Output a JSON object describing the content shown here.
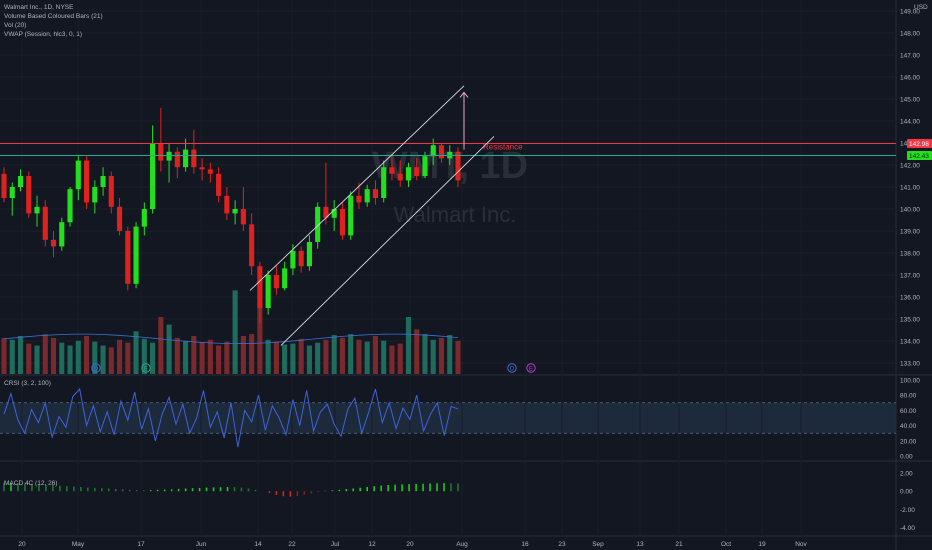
{
  "header": {
    "symbol_line": "Walmart Inc., 1D, NYSE",
    "indicators": [
      "Volume Based Coloured Bars (21)",
      "Vol (20)",
      "VWAP (Session, hlc3, 0, 1)"
    ],
    "currency": "USD"
  },
  "watermark": {
    "ticker": "WMT, 1D",
    "name": "Walmart Inc."
  },
  "price_labels": {
    "resistance_value": "142.98",
    "last_value": "142.43"
  },
  "annotations": {
    "resistance": "Resistance"
  },
  "colors": {
    "up": "#22e01e",
    "down": "#e0221e",
    "background": "#131722",
    "resistance_line": "#f23645",
    "support_line": "#22ab94",
    "crsi": "#3e63d8",
    "arrow": "#e8a5c8"
  },
  "event_markers": [
    "D",
    "E",
    "D",
    "E"
  ],
  "chart_data": [
    {
      "type": "candlestick",
      "title": "Walmart Inc., 1D, NYSE",
      "y_range": [
        132.5,
        149.5
      ],
      "y_ticks": [
        "149.00",
        "148.00",
        "147.00",
        "146.00",
        "145.00",
        "144.00",
        "143.00",
        "142.00",
        "141.00",
        "140.00",
        "139.00",
        "138.00",
        "137.00",
        "136.00",
        "135.00",
        "134.00",
        "133.00"
      ],
      "x_ticks": [
        "20",
        "May",
        "17",
        "Jun",
        "14",
        "22",
        "Jul",
        "12",
        "20",
        "Aug",
        "16",
        "23",
        "Sep",
        "13",
        "21",
        "Oct",
        "19",
        "Nov"
      ],
      "levels": {
        "resistance": 142.98,
        "support": 142.43
      },
      "channel_upper": [
        [
          137.4,
          137.0
        ],
        [
          142.8,
          143.6
        ]
      ],
      "ohlc_approx": [
        {
          "o": 141.6,
          "h": 141.9,
          "l": 140.3,
          "c": 140.5
        },
        {
          "o": 140.5,
          "h": 141.2,
          "l": 139.7,
          "c": 141.0
        },
        {
          "o": 141.0,
          "h": 141.8,
          "l": 140.8,
          "c": 141.5
        },
        {
          "o": 141.5,
          "h": 141.7,
          "l": 139.6,
          "c": 139.8
        },
        {
          "o": 139.8,
          "h": 140.6,
          "l": 139.2,
          "c": 140.1
        },
        {
          "o": 140.1,
          "h": 140.4,
          "l": 138.3,
          "c": 138.6
        },
        {
          "o": 138.6,
          "h": 139.0,
          "l": 137.8,
          "c": 138.3
        },
        {
          "o": 138.3,
          "h": 139.6,
          "l": 138.1,
          "c": 139.4
        },
        {
          "o": 139.4,
          "h": 141.0,
          "l": 139.2,
          "c": 140.9
        },
        {
          "o": 140.9,
          "h": 142.4,
          "l": 140.4,
          "c": 142.2
        },
        {
          "o": 142.2,
          "h": 142.4,
          "l": 140.0,
          "c": 140.3
        },
        {
          "o": 140.3,
          "h": 141.3,
          "l": 139.8,
          "c": 141.0
        },
        {
          "o": 141.0,
          "h": 141.9,
          "l": 140.6,
          "c": 141.5
        },
        {
          "o": 141.5,
          "h": 141.7,
          "l": 139.8,
          "c": 140.1
        },
        {
          "o": 140.1,
          "h": 140.5,
          "l": 138.8,
          "c": 139.0
        },
        {
          "o": 139.0,
          "h": 139.2,
          "l": 136.3,
          "c": 136.6
        },
        {
          "o": 136.6,
          "h": 139.4,
          "l": 136.4,
          "c": 139.2
        },
        {
          "o": 139.2,
          "h": 140.3,
          "l": 138.8,
          "c": 140.0
        },
        {
          "o": 140.0,
          "h": 143.8,
          "l": 139.8,
          "c": 143.0
        },
        {
          "o": 143.0,
          "h": 144.6,
          "l": 141.7,
          "c": 142.2
        },
        {
          "o": 142.2,
          "h": 143.0,
          "l": 141.2,
          "c": 142.6
        },
        {
          "o": 142.6,
          "h": 142.8,
          "l": 141.4,
          "c": 141.9
        },
        {
          "o": 141.9,
          "h": 143.2,
          "l": 141.7,
          "c": 142.7
        },
        {
          "o": 142.7,
          "h": 143.6,
          "l": 141.6,
          "c": 141.9
        },
        {
          "o": 141.9,
          "h": 142.3,
          "l": 141.3,
          "c": 141.8
        },
        {
          "o": 141.8,
          "h": 142.1,
          "l": 141.2,
          "c": 141.6
        },
        {
          "o": 141.6,
          "h": 141.9,
          "l": 140.3,
          "c": 140.6
        },
        {
          "o": 140.6,
          "h": 141.0,
          "l": 139.5,
          "c": 139.8
        },
        {
          "o": 139.8,
          "h": 140.4,
          "l": 139.3,
          "c": 140.0
        },
        {
          "o": 140.0,
          "h": 141.0,
          "l": 139.0,
          "c": 139.3
        },
        {
          "o": 139.3,
          "h": 139.8,
          "l": 137.0,
          "c": 137.4
        },
        {
          "o": 137.4,
          "h": 137.6,
          "l": 134.8,
          "c": 135.5
        },
        {
          "o": 135.5,
          "h": 137.2,
          "l": 135.2,
          "c": 137.0
        },
        {
          "o": 137.0,
          "h": 137.4,
          "l": 136.1,
          "c": 136.4
        },
        {
          "o": 136.4,
          "h": 137.6,
          "l": 136.3,
          "c": 137.3
        },
        {
          "o": 137.3,
          "h": 138.4,
          "l": 137.0,
          "c": 138.1
        },
        {
          "o": 138.1,
          "h": 138.3,
          "l": 137.1,
          "c": 137.4
        },
        {
          "o": 137.4,
          "h": 138.8,
          "l": 137.2,
          "c": 138.5
        },
        {
          "o": 138.5,
          "h": 140.3,
          "l": 138.2,
          "c": 140.1
        },
        {
          "o": 140.1,
          "h": 142.1,
          "l": 139.3,
          "c": 139.6
        },
        {
          "o": 139.6,
          "h": 140.4,
          "l": 139.0,
          "c": 140.0
        },
        {
          "o": 140.0,
          "h": 140.3,
          "l": 138.6,
          "c": 138.8
        },
        {
          "o": 138.8,
          "h": 140.8,
          "l": 138.6,
          "c": 140.6
        },
        {
          "o": 140.6,
          "h": 141.2,
          "l": 140.0,
          "c": 140.3
        },
        {
          "o": 140.3,
          "h": 141.1,
          "l": 140.1,
          "c": 140.9
        },
        {
          "o": 140.9,
          "h": 141.3,
          "l": 140.2,
          "c": 140.5
        },
        {
          "o": 140.5,
          "h": 142.2,
          "l": 140.3,
          "c": 141.9
        },
        {
          "o": 141.9,
          "h": 142.4,
          "l": 141.3,
          "c": 141.6
        },
        {
          "o": 141.6,
          "h": 142.2,
          "l": 141.0,
          "c": 141.3
        },
        {
          "o": 141.3,
          "h": 142.1,
          "l": 141.0,
          "c": 141.9
        },
        {
          "o": 141.9,
          "h": 142.3,
          "l": 141.3,
          "c": 141.5
        },
        {
          "o": 141.5,
          "h": 142.6,
          "l": 141.4,
          "c": 142.4
        },
        {
          "o": 142.4,
          "h": 143.2,
          "l": 142.0,
          "c": 142.9
        },
        {
          "o": 142.9,
          "h": 143.0,
          "l": 142.1,
          "c": 142.3
        },
        {
          "o": 142.3,
          "h": 142.9,
          "l": 142.0,
          "c": 142.6
        },
        {
          "o": 142.6,
          "h": 142.8,
          "l": 141.0,
          "c": 141.3
        }
      ]
    },
    {
      "type": "line",
      "title": "CRSI (3, 2, 100)",
      "y_range": [
        -5,
        105
      ],
      "y_ticks": [
        "100.00",
        "80.00",
        "60.00",
        "40.00",
        "20.00",
        "0.00"
      ],
      "bands": [
        70,
        30
      ],
      "values": [
        55,
        82,
        48,
        30,
        61,
        44,
        70,
        25,
        52,
        38,
        78,
        88,
        40,
        66,
        32,
        58,
        28,
        72,
        47,
        84,
        35,
        62,
        20,
        55,
        77,
        42,
        68,
        30,
        50,
        86,
        38,
        58,
        24,
        70,
        12,
        60,
        45,
        80,
        34,
        66,
        50,
        28,
        74,
        40,
        86,
        33,
        58,
        68,
        42,
        26,
        62,
        76,
        30,
        57,
        88,
        44,
        70,
        36,
        63,
        48,
        80,
        33,
        55,
        70,
        27,
        65,
        62
      ]
    },
    {
      "type": "bar",
      "title": "MACD 4C (12, 26)",
      "y_range": [
        -4.8,
        3.2
      ],
      "y_ticks": [
        "2.00",
        "0.00",
        "-2.00",
        "-4.00"
      ],
      "values": [
        0.9,
        0.92,
        0.88,
        0.85,
        0.8,
        0.76,
        0.7,
        0.68,
        0.6,
        0.55,
        0.5,
        0.46,
        0.4,
        0.36,
        0.32,
        0.28,
        0.24,
        0.2,
        0.15,
        0.12,
        0.1,
        0.12,
        0.15,
        0.18,
        0.2,
        0.25,
        0.3,
        0.33,
        0.36,
        0.4,
        0.42,
        0.44,
        0.46,
        0.45,
        0.4,
        0.3,
        0.15,
        0.0,
        -0.2,
        -0.4,
        -0.55,
        -0.6,
        -0.52,
        -0.4,
        -0.25,
        -0.1,
        0.05,
        0.1,
        0.15,
        0.22,
        0.3,
        0.38,
        0.46,
        0.55,
        0.62,
        0.68,
        0.72,
        0.75,
        0.78,
        0.8,
        0.82,
        0.85,
        0.86,
        0.88,
        0.86,
        0.85
      ]
    }
  ]
}
